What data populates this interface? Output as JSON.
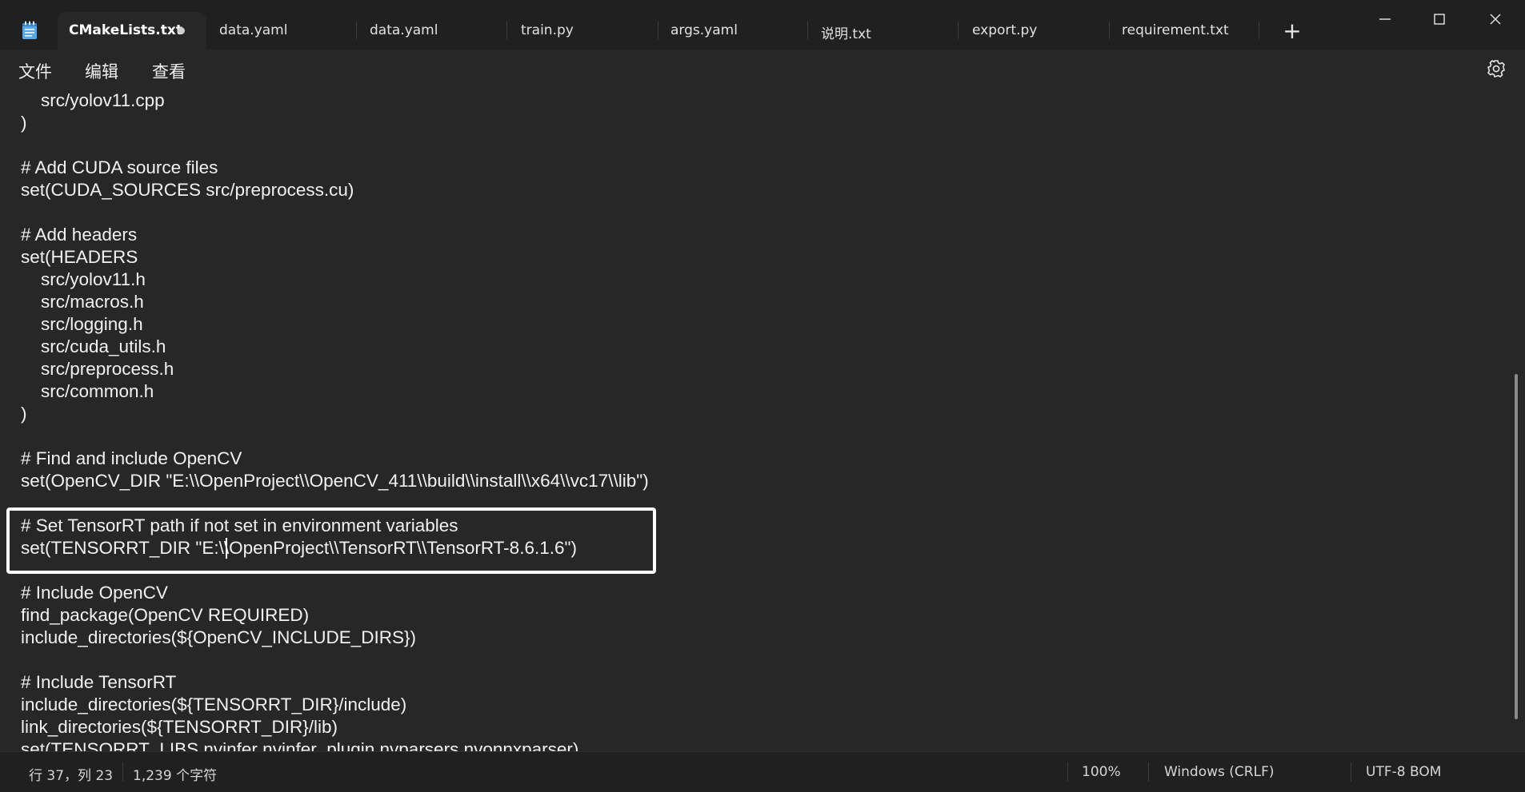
{
  "tabs": [
    {
      "label": "CMakeLists.txt",
      "active": true,
      "modified": true
    },
    {
      "label": "data.yaml",
      "active": false
    },
    {
      "label": "data.yaml",
      "active": false
    },
    {
      "label": "train.py",
      "active": false
    },
    {
      "label": "args.yaml",
      "active": false
    },
    {
      "label": "说明.txt",
      "active": false
    },
    {
      "label": "export.py",
      "active": false
    },
    {
      "label": "requirement.txt",
      "active": false
    }
  ],
  "new_tab_label": "+",
  "window_controls": [
    "minimize-icon",
    "maximize-icon",
    "close-icon"
  ],
  "menu": {
    "file": "文件",
    "edit": "编辑",
    "view": "查看"
  },
  "editor": {
    "lines": [
      "    src/yolov11.cpp",
      ")",
      "",
      "# Add CUDA source files",
      "set(CUDA_SOURCES src/preprocess.cu)",
      "",
      "# Add headers",
      "set(HEADERS",
      "    src/yolov11.h",
      "    src/macros.h",
      "    src/logging.h",
      "    src/cuda_utils.h",
      "    src/preprocess.h",
      "    src/common.h",
      ")",
      "",
      "# Find and include OpenCV",
      "set(OpenCV_DIR \"E:\\\\OpenProject\\\\OpenCV_411\\\\build\\\\install\\\\x64\\\\vc17\\\\lib\")",
      "",
      "# Set TensorRT path if not set in environment variables",
      "set(TENSORRT_DIR \"E:\\\\OpenProject\\\\TensorRT\\\\TensorRT-8.6.1.6\")",
      "",
      "# Include OpenCV",
      "find_package(OpenCV REQUIRED)",
      "include_directories(${OpenCV_INCLUDE_DIRS})",
      "",
      "# Include TensorRT",
      "include_directories(${TENSORRT_DIR}/include)",
      "link_directories(${TENSORRT_DIR}/lib)",
      "set(TENSORRT_LIBS nvinfer nvinfer_plugin nvparsers nvonnxparser)"
    ]
  },
  "status": {
    "position": "行 37，列 23",
    "char_count": "1,239 个字符",
    "zoom": "100%",
    "line_ending": "Windows (CRLF)",
    "encoding": "UTF-8 BOM"
  },
  "colors": {
    "background": "#272727",
    "titlebar": "#202020",
    "text": "#f2f2f2",
    "highlight_border": "#ffffff"
  }
}
